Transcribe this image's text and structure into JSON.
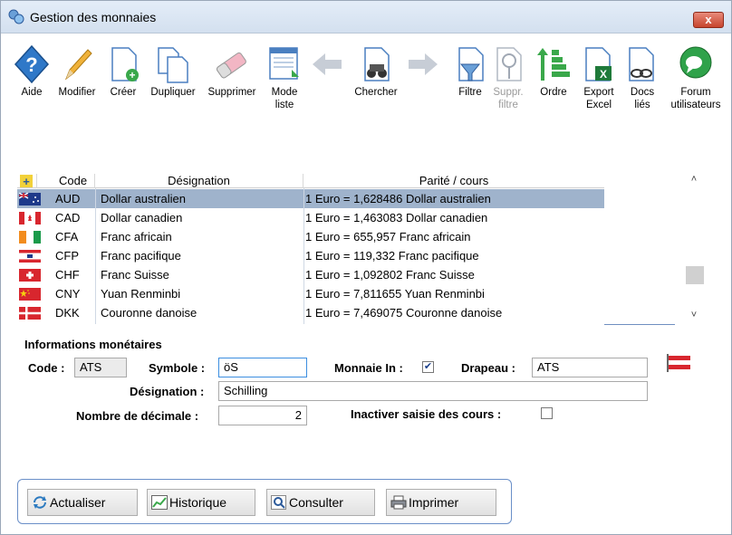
{
  "window": {
    "title": "Gestion des monnaies",
    "close_label": "x"
  },
  "toolbar": {
    "aide": "Aide",
    "modifier": "Modifier",
    "creer": "Créer",
    "dupliquer": "Dupliquer",
    "supprimer": "Supprimer",
    "mode_liste_1": "Mode",
    "mode_liste_2": "liste",
    "chercher": "Chercher",
    "filtre": "Filtre",
    "suppr_filtre_1": "Suppr.",
    "suppr_filtre_2": "filtre",
    "ordre": "Ordre",
    "export_1": "Export",
    "export_2": "Excel",
    "docs_1": "Docs",
    "docs_2": "liés",
    "forum_1": "Forum",
    "forum_2": "utilisateurs"
  },
  "grid": {
    "headers": {
      "code": "Code",
      "designation": "Désignation",
      "parite": "Parité / cours"
    },
    "rows": [
      {
        "code": "AUD",
        "designation": "Dollar australien",
        "parite": "1 Euro = 1,628486 Dollar australien",
        "flag": "australia-flag-icon"
      },
      {
        "code": "CAD",
        "designation": "Dollar canadien",
        "parite": "1 Euro = 1,463083 Dollar canadien",
        "flag": "canada-flag-icon"
      },
      {
        "code": "CFA",
        "designation": "Franc africain",
        "parite": "1 Euro = 655,957 Franc africain",
        "flag": "ivory-coast-flag-icon"
      },
      {
        "code": "CFP",
        "designation": "Franc pacifique",
        "parite": "1 Euro = 119,332 Franc pacifique",
        "flag": "french-polynesia-flag-icon"
      },
      {
        "code": "CHF",
        "designation": "Franc Suisse",
        "parite": "1 Euro = 1,092802 Franc Suisse",
        "flag": "switzerland-flag-icon"
      },
      {
        "code": "CNY",
        "designation": "Yuan Renminbi",
        "parite": "1 Euro = 7,811655 Yuan Renminbi",
        "flag": "china-flag-icon"
      },
      {
        "code": "DKK",
        "designation": "Couronne danoise",
        "parite": "1 Euro = 7,469075 Couronne danoise",
        "flag": "denmark-flag-icon"
      }
    ],
    "selected_index": 0
  },
  "info": {
    "section_title": "Informations monétaires",
    "code_label": "Code :",
    "code_value": "ATS",
    "symbole_label": "Symbole :",
    "symbole_value": "öS",
    "monnaie_in_label": "Monnaie In :",
    "monnaie_in_checked": true,
    "drapeau_label": "Drapeau :",
    "drapeau_value": "ATS",
    "designation_label": "Désignation :",
    "designation_value": "Schilling",
    "decimales_label": "Nombre de décimale :",
    "decimales_value": "2",
    "inactiver_label": "Inactiver saisie des cours :",
    "inactiver_checked": false
  },
  "buttons": {
    "actualiser": "Actualiser",
    "historique": "Historique",
    "consulter": "Consulter",
    "imprimer": "Imprimer"
  },
  "colors": {
    "selection": "#9fb3cc",
    "accent": "#3c8ee0"
  }
}
